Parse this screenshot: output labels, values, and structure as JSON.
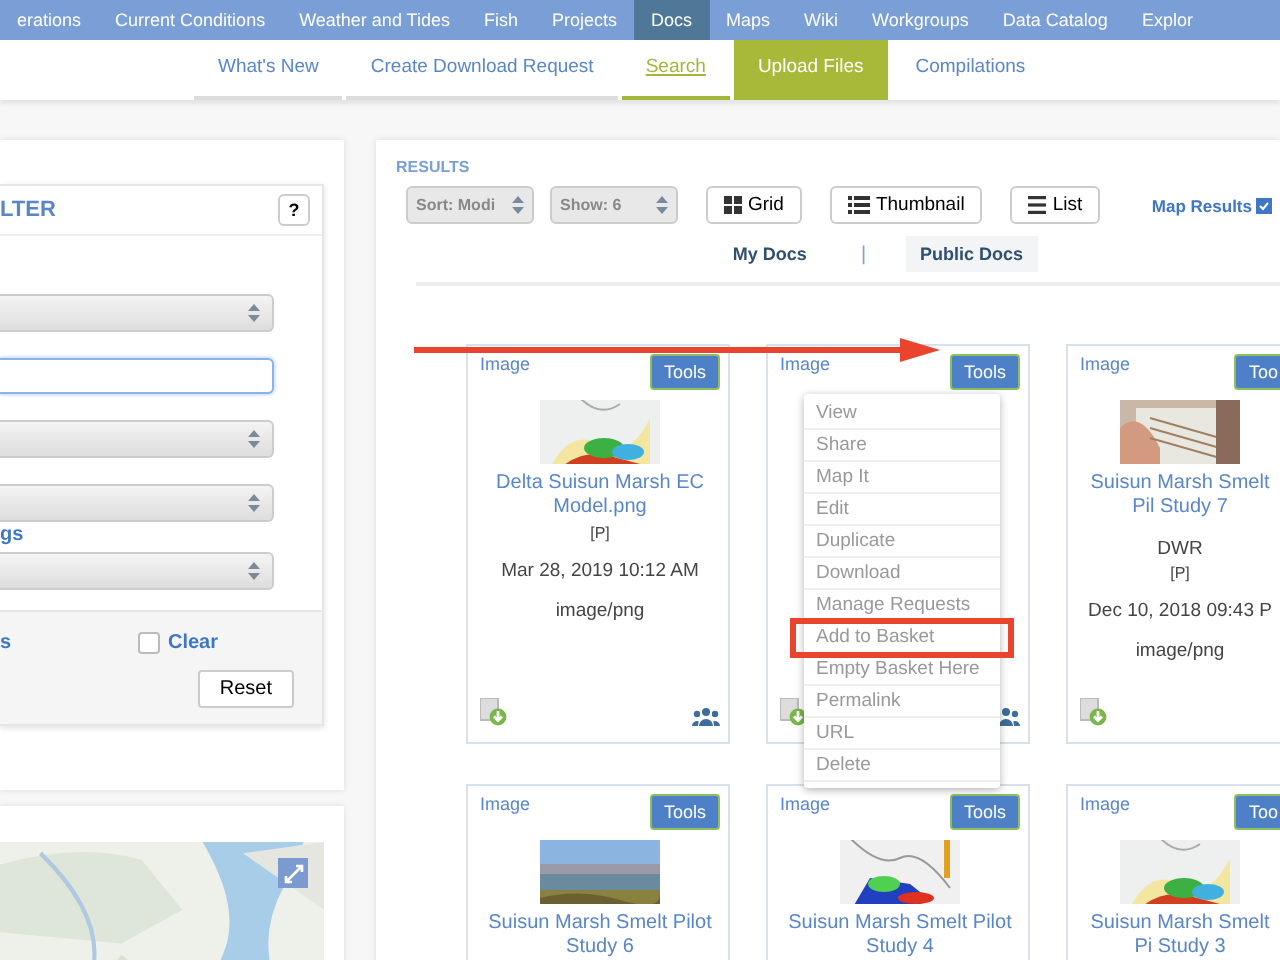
{
  "top_nav": [
    {
      "label": "erations",
      "selected": false
    },
    {
      "label": "Current Conditions",
      "selected": false
    },
    {
      "label": "Weather and Tides",
      "selected": false
    },
    {
      "label": "Fish",
      "selected": false
    },
    {
      "label": "Projects",
      "selected": false
    },
    {
      "label": "Docs",
      "selected": true
    },
    {
      "label": "Maps",
      "selected": false
    },
    {
      "label": "Wiki",
      "selected": false
    },
    {
      "label": "Workgroups",
      "selected": false
    },
    {
      "label": "Data Catalog",
      "selected": false
    },
    {
      "label": "Explor",
      "selected": false
    }
  ],
  "sub_nav": [
    {
      "label": "What's New",
      "kind": "link",
      "selected": false
    },
    {
      "label": "Create Download Request",
      "kind": "link",
      "selected": false
    },
    {
      "label": "Search",
      "kind": "link",
      "selected": true
    },
    {
      "label": "Upload Files",
      "kind": "button",
      "selected": false
    },
    {
      "label": "Compilations",
      "kind": "link",
      "selected": false
    }
  ],
  "filter": {
    "title": "LTER",
    "help": "?",
    "fields": [
      {
        "kind": "select"
      },
      {
        "kind": "input",
        "focused": true
      },
      {
        "kind": "select"
      },
      {
        "kind": "select"
      },
      {
        "kind": "link",
        "label": "gs"
      },
      {
        "kind": "select"
      }
    ],
    "footer_link": "s",
    "clear": {
      "label": "Clear",
      "checked": false
    },
    "reset": "Reset"
  },
  "results": {
    "title": "RESULTS",
    "sort": "Sort: Modi",
    "show": "Show: 6",
    "views": [
      {
        "label": "Grid",
        "kind": "grid"
      },
      {
        "label": "Thumbnail",
        "kind": "thumbnail"
      },
      {
        "label": "List",
        "kind": "list"
      }
    ],
    "map_results": {
      "label": "Map Results",
      "checked": true
    },
    "tabs": [
      {
        "label": "My Docs",
        "selected": false
      },
      {
        "label": "Public Docs",
        "selected": true
      }
    ],
    "separator": "|",
    "cards": [
      {
        "type": "Image",
        "tools": "Tools",
        "title": "Delta Suisun Marsh EC Model.png",
        "access": "[P]",
        "date": "Mar 28, 2019 10:12 AM",
        "format": "image/png",
        "downloadable": true,
        "shared": true
      },
      {
        "type": "Image",
        "tools": "Tools",
        "downloadable": true,
        "shared": true
      },
      {
        "type": "Image",
        "tools": "Too",
        "title": "Suisun Marsh Smelt Pil Study 7",
        "owner": "DWR",
        "access": "[P]",
        "date": "Dec 10, 2018 09:43 P",
        "format": "image/png",
        "downloadable": true,
        "shared": false
      },
      {
        "type": "Image",
        "tools": "Tools",
        "title": "Suisun Marsh Smelt Pilot Study 6"
      },
      {
        "type": "Image",
        "tools": "Tools",
        "title": "Suisun Marsh Smelt Pilot Study 4"
      },
      {
        "type": "Image",
        "tools": "Too",
        "title": "Suisun Marsh Smelt Pi Study 3"
      }
    ],
    "tools_menu": [
      {
        "label": "View",
        "marked": false
      },
      {
        "label": "Share",
        "marked": false
      },
      {
        "label": "Map It",
        "marked": false
      },
      {
        "label": "Edit",
        "marked": false
      },
      {
        "label": "Duplicate",
        "marked": false
      },
      {
        "label": "Download",
        "marked": false
      },
      {
        "label": "Manage Requests",
        "marked": false
      },
      {
        "label": "Add to Basket",
        "marked": true
      },
      {
        "label": "Empty Basket Here",
        "marked": false
      },
      {
        "label": "Permalink",
        "marked": false
      },
      {
        "label": "URL",
        "marked": false
      },
      {
        "label": "Delete",
        "marked": false
      }
    ],
    "pointer_arrow": true
  }
}
